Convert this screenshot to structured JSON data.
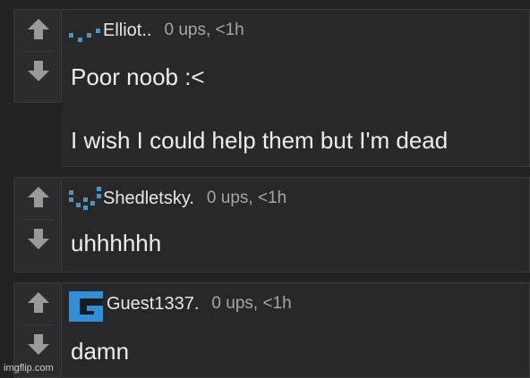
{
  "comments": [
    {
      "username": "Elliot..",
      "meta": "0 ups, <1h",
      "lines": [
        "Poor noob :<",
        "I wish I could help them but I'm dead"
      ]
    },
    {
      "username": "Shedletsky.",
      "meta": "0 ups, <1h",
      "lines": [
        "uhhhhhh"
      ]
    },
    {
      "username": "Guest1337.",
      "meta": "0 ups, <1h",
      "lines": [
        "damn"
      ]
    }
  ],
  "colors": {
    "accent": "#3a9ad9",
    "background": "#222224",
    "text": "#ededed",
    "meta": "#a5a5a5"
  },
  "icons": {
    "upvote": "arrow-up-icon",
    "downvote": "arrow-down-icon"
  },
  "watermark": "imgflip.com"
}
